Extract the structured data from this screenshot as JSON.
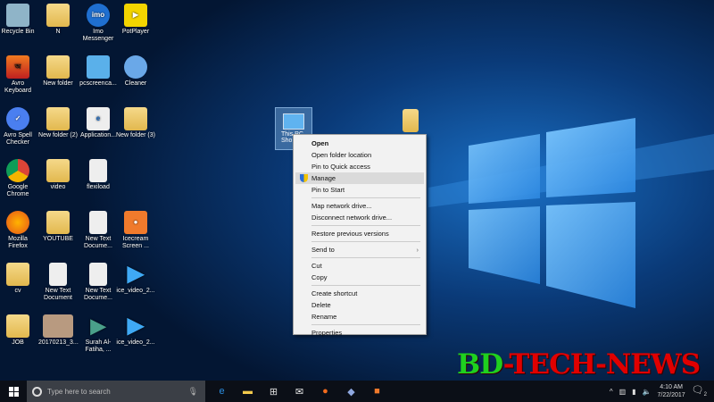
{
  "desktop_icons": [
    {
      "label": "Recycle Bin",
      "type": "bin",
      "col": 0,
      "row": 0
    },
    {
      "label": "N",
      "type": "folder",
      "col": 1,
      "row": 0
    },
    {
      "label": "Imo Messenger",
      "type": "imo",
      "col": 2,
      "row": 0
    },
    {
      "label": "PotPlayer",
      "type": "pot",
      "col": 3,
      "row": 0
    },
    {
      "label": "Avro Keyboard",
      "type": "avro",
      "col": 0,
      "row": 1
    },
    {
      "label": "New folder",
      "type": "folder",
      "col": 1,
      "row": 1
    },
    {
      "label": "pcscreenca...",
      "type": "pc",
      "col": 2,
      "row": 1
    },
    {
      "label": "Cleaner",
      "type": "cleaner",
      "col": 3,
      "row": 1
    },
    {
      "label": "Avro Spell Checker",
      "type": "check",
      "col": 0,
      "row": 2
    },
    {
      "label": "New folder (2)",
      "type": "folder",
      "col": 1,
      "row": 2
    },
    {
      "label": "Application...",
      "type": "pdf",
      "col": 2,
      "row": 2
    },
    {
      "label": "New folder (3)",
      "type": "folder",
      "col": 3,
      "row": 2
    },
    {
      "label": "Google Chrome",
      "type": "chrome",
      "col": 0,
      "row": 3
    },
    {
      "label": "video",
      "type": "folder",
      "col": 1,
      "row": 3
    },
    {
      "label": "flexiload",
      "type": "doc",
      "col": 2,
      "row": 3
    },
    {
      "label": "Mozilla Firefox",
      "type": "firefox",
      "col": 0,
      "row": 4
    },
    {
      "label": "YOUTUBE",
      "type": "folder",
      "col": 1,
      "row": 4
    },
    {
      "label": "New Text Docume...",
      "type": "doc",
      "col": 2,
      "row": 4
    },
    {
      "label": "Icecream Screen ...",
      "type": "ice",
      "col": 3,
      "row": 4
    },
    {
      "label": "cv",
      "type": "folder",
      "col": 0,
      "row": 5
    },
    {
      "label": "New Text Document",
      "type": "doc",
      "col": 1,
      "row": 5
    },
    {
      "label": "New Text Docume...",
      "type": "doc",
      "col": 2,
      "row": 5
    },
    {
      "label": "ice_video_2...",
      "type": "play",
      "col": 3,
      "row": 5
    },
    {
      "label": "JOB",
      "type": "folder",
      "col": 0,
      "row": 6
    },
    {
      "label": "20170213_3...",
      "type": "photo",
      "col": 1,
      "row": 6
    },
    {
      "label": "Surah Al-Fatiha, ...",
      "type": "mp3",
      "col": 2,
      "row": 6
    },
    {
      "label": "ice_video_2...",
      "type": "play",
      "col": 3,
      "row": 6
    }
  ],
  "selected_icon": {
    "label": "This PC Sho..."
  },
  "context_menu": [
    {
      "label": "Open",
      "bold": true
    },
    {
      "label": "Open folder location"
    },
    {
      "label": "Pin to Quick access"
    },
    {
      "label": "Manage",
      "highlighted": true,
      "icon": "shield-icon"
    },
    {
      "label": "Pin to Start"
    },
    {
      "sep": true
    },
    {
      "label": "Map network drive..."
    },
    {
      "label": "Disconnect network drive..."
    },
    {
      "sep": true
    },
    {
      "label": "Restore previous versions"
    },
    {
      "sep": true
    },
    {
      "label": "Send to",
      "submenu": true
    },
    {
      "sep": true
    },
    {
      "label": "Cut"
    },
    {
      "label": "Copy"
    },
    {
      "sep": true
    },
    {
      "label": "Create shortcut"
    },
    {
      "label": "Delete"
    },
    {
      "label": "Rename"
    },
    {
      "sep": true
    },
    {
      "label": "Properties"
    }
  ],
  "watermark": {
    "part1": "BD",
    "part2": "-TECH-NEWS"
  },
  "taskbar": {
    "search_placeholder": "Type here to search",
    "apps": [
      {
        "name": "edge-icon",
        "glyph": "e",
        "color": "#2b8de0"
      },
      {
        "name": "file-explorer-icon",
        "glyph": "▬",
        "color": "#f2c94c"
      },
      {
        "name": "store-icon",
        "glyph": "⊞",
        "color": "#ddd"
      },
      {
        "name": "mail-icon",
        "glyph": "✉",
        "color": "#eee"
      },
      {
        "name": "firefox-icon",
        "glyph": "●",
        "color": "#f26b1d"
      },
      {
        "name": "network-app-icon",
        "glyph": "◆",
        "color": "#8fa8e0"
      },
      {
        "name": "icecream-icon",
        "glyph": "■",
        "color": "#f07a2c"
      }
    ],
    "time": "4:10 AM",
    "date": "7/22/2017",
    "notification_count": "2"
  }
}
